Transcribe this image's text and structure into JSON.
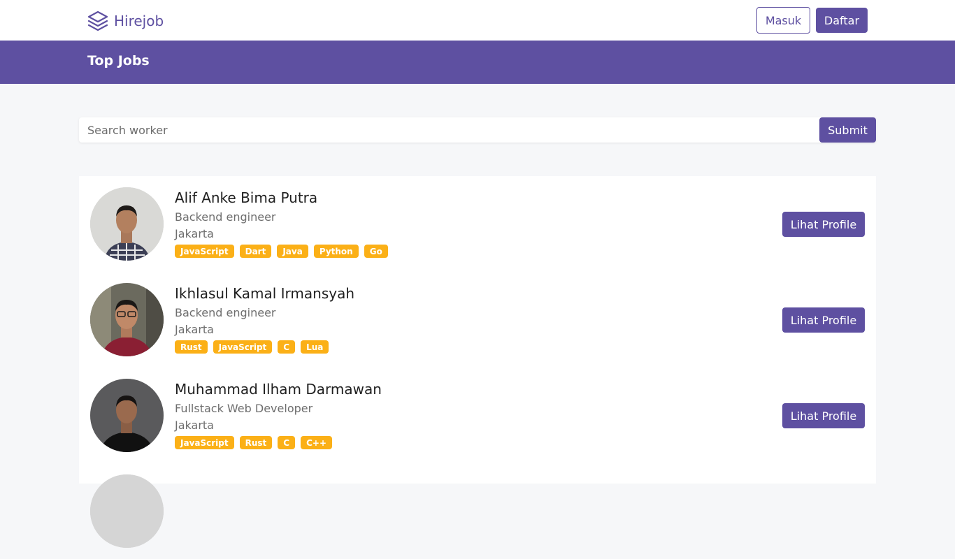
{
  "navbar": {
    "brand": "Hirejob",
    "login_label": "Masuk",
    "register_label": "Daftar"
  },
  "banner": {
    "title": "Top Jobs"
  },
  "search": {
    "placeholder": "Search worker",
    "value": "",
    "submit_label": "Submit"
  },
  "workers": [
    {
      "name": "Alif Anke Bima Putra",
      "job": "Backend engineer",
      "location": "Jakarta",
      "skills": [
        "JavaScript",
        "Dart",
        "Java",
        "Python",
        "Go"
      ],
      "button": "Lihat Profile"
    },
    {
      "name": "Ikhlasul Kamal Irmansyah",
      "job": "Backend engineer",
      "location": "Jakarta",
      "skills": [
        "Rust",
        "JavaScript",
        "C",
        "Lua"
      ],
      "button": "Lihat Profile"
    },
    {
      "name": "Muhammad Ilham Darmawan",
      "job": "Fullstack Web Developer",
      "location": "Jakarta",
      "skills": [
        "JavaScript",
        "Rust",
        "C",
        "C++"
      ],
      "button": "Lihat Profile"
    }
  ],
  "colors": {
    "primary": "#5e50a1",
    "skill_badge": "#fbb017",
    "page_bg": "#f6f7f9"
  }
}
